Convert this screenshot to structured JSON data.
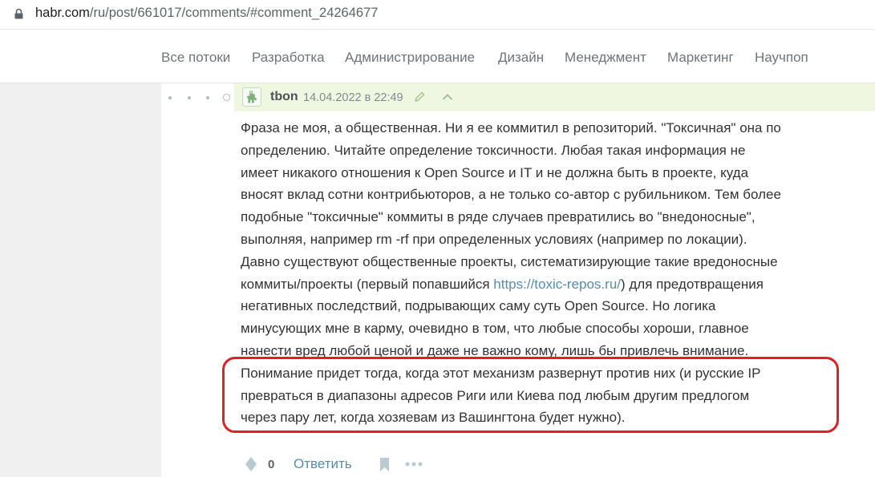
{
  "browser": {
    "url_host": "habr.com",
    "url_path": "/ru/post/661017/comments/#comment_24264677"
  },
  "nav": {
    "items": [
      "Все потоки",
      "Разработка",
      "Администрирование",
      "Дизайн",
      "Менеджмент",
      "Маркетинг",
      "Научпоп"
    ]
  },
  "comment": {
    "author": "tbon",
    "date": "14.04.2022 в 22:49",
    "text_lines": [
      "Фраза не моя, а общественная. Ни я ее коммитил в репозиторий. \"Токсичная\" она по",
      "определению. Читайте определение токсичности. Любая такая информация не",
      "имеет никакого отношения к Open Source и IT и не должна быть в проекте, куда",
      "вносят вклад сотни контрибьюторов, а не только со-автор с рубильником. Тем более",
      "подобные \"токсичные\" коммиты в ряде случаев превратились во \"внедоносные\",",
      "выполняя, например rm -rf при определенных условиях (например по локации).",
      "Давно существуют общественные проекты, систематизирующие такие вредоносные"
    ],
    "link_line_before": "коммиты/проекты (первый попавшийся ",
    "link_text": "https://toxic-repos.ru/",
    "link_line_after": ") для предотвращения",
    "text_lines_2": [
      "негативных последствий, подрывающих саму суть Open Source. Но логика",
      "минусующих мне в карму, очевидно в том, что любые способы хороши, главное",
      "нанести вред любой ценой и даже не важно кому, лишь бы привлечь внимание."
    ],
    "highlighted_lines": [
      "Понимание придет тогда, когда этот механизм развернут против них (и русские IP",
      "превраться в диапазоны адресов Риги или Киева под любым другим предлогом",
      "через пару лет, когда хозяевам из Вашингтона будет нужно)."
    ],
    "score": "0",
    "reply_label": "Ответить"
  },
  "colors": {
    "accent_link": "#548eaa",
    "meta_bar": "#f0f7e0",
    "highlight_border": "#e21f26"
  },
  "icons": [
    "lock-icon",
    "avatar-icon",
    "edit-icon",
    "chevron-up-icon",
    "vote-icon",
    "bookmark-icon",
    "more-icon"
  ]
}
